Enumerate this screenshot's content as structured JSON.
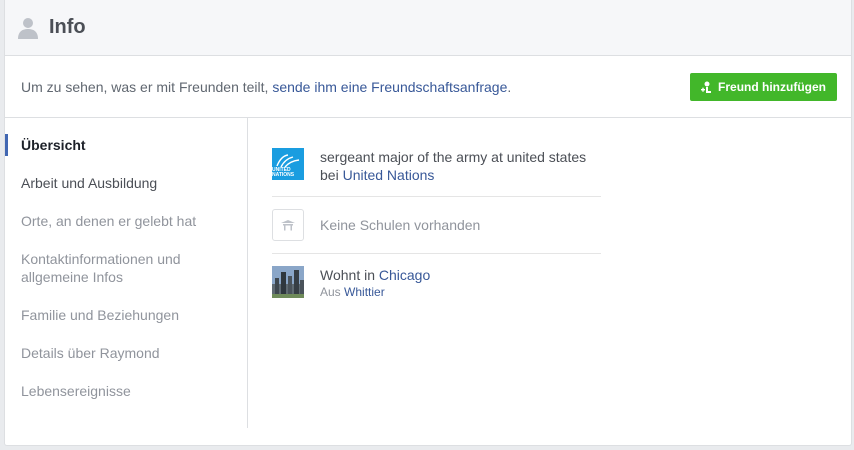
{
  "header": {
    "title": "Info"
  },
  "notice": {
    "prefix": "Um zu sehen, was er mit Freunden teilt,",
    "link": "sende ihm eine Freundschaftsanfrage",
    "suffix": ".",
    "button_label": "Freund hinzufügen"
  },
  "sidebar": {
    "items": [
      {
        "label": "Übersicht"
      },
      {
        "label": "Arbeit und Ausbildung"
      },
      {
        "label": "Orte, an denen er gelebt hat"
      },
      {
        "label": "Kontaktinformationen und allgemeine Infos"
      },
      {
        "label": "Familie und Beziehungen"
      },
      {
        "label": "Details über Raymond"
      },
      {
        "label": "Lebensereignisse"
      }
    ]
  },
  "overview": {
    "work": {
      "text": "sergeant major of the army at united states bei",
      "org": "United Nations",
      "logo_text": "UNITED NATIONS"
    },
    "school": {
      "text": "Keine Schulen vorhanden"
    },
    "home": {
      "prefix": "Wohnt in",
      "city": "Chicago",
      "from_prefix": "Aus",
      "from_city": "Whittier"
    }
  },
  "colors": {
    "accent": "#4267b2",
    "link": "#385898",
    "button": "#42b72a"
  },
  "icons": {
    "header": "person-icon",
    "button": "add-friend-icon",
    "work": "united-nations-logo",
    "school": "school-icon",
    "home": "city-photo"
  }
}
